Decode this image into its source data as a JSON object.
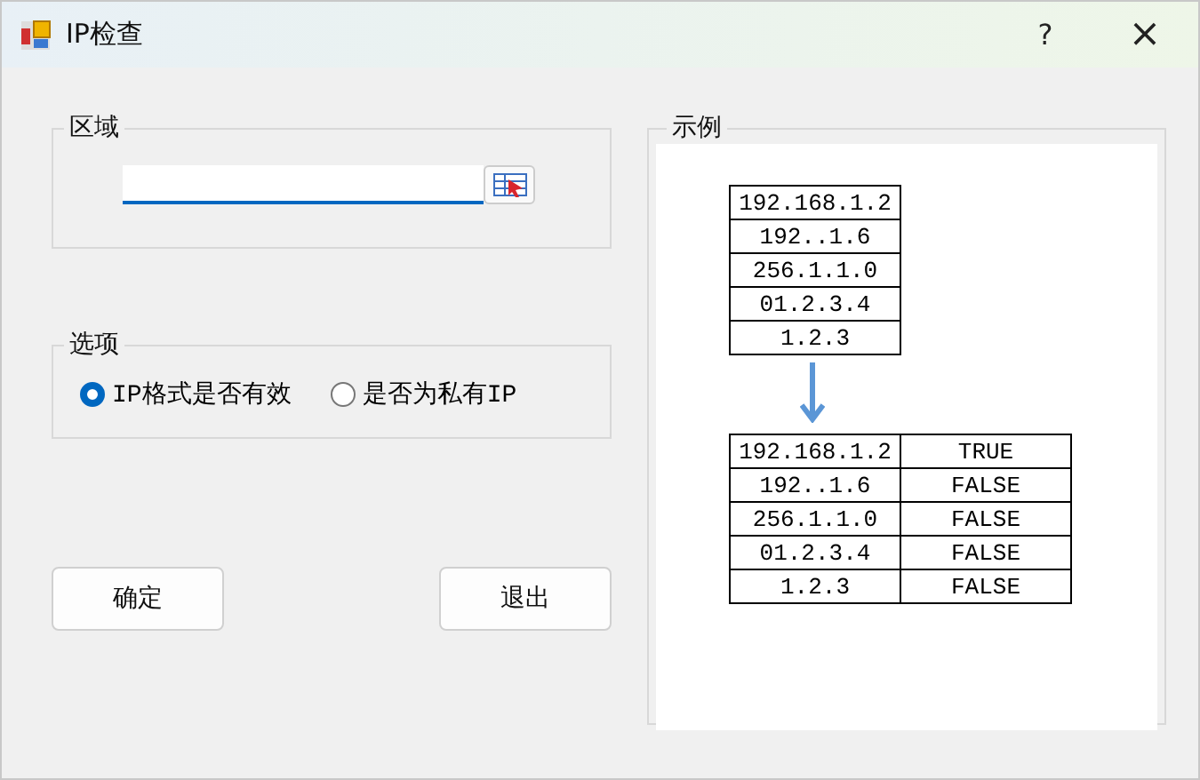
{
  "window": {
    "title": "IP检查",
    "help": "?",
    "close": "×"
  },
  "region": {
    "title": "区域"
  },
  "options": {
    "title": "选项",
    "radios": [
      {
        "label": "IP格式是否有效",
        "selected": true
      },
      {
        "label": "是否为私有IP",
        "selected": false
      }
    ]
  },
  "buttons": [
    {
      "label": "确定"
    },
    {
      "label": "退出"
    }
  ],
  "example": {
    "title": "示例",
    "input_rows": [
      "192.168.1.2",
      "192..1.6",
      "256.1.1.0",
      "01.2.3.4",
      "1.2.3"
    ],
    "result_rows": [
      {
        "ip": "192.168.1.2",
        "result": "TRUE"
      },
      {
        "ip": "192..1.6",
        "result": "FALSE"
      },
      {
        "ip": "256.1.1.0",
        "result": "FALSE"
      },
      {
        "ip": "01.2.3.4",
        "result": "FALSE"
      },
      {
        "ip": "1.2.3",
        "result": "FALSE"
      }
    ]
  }
}
